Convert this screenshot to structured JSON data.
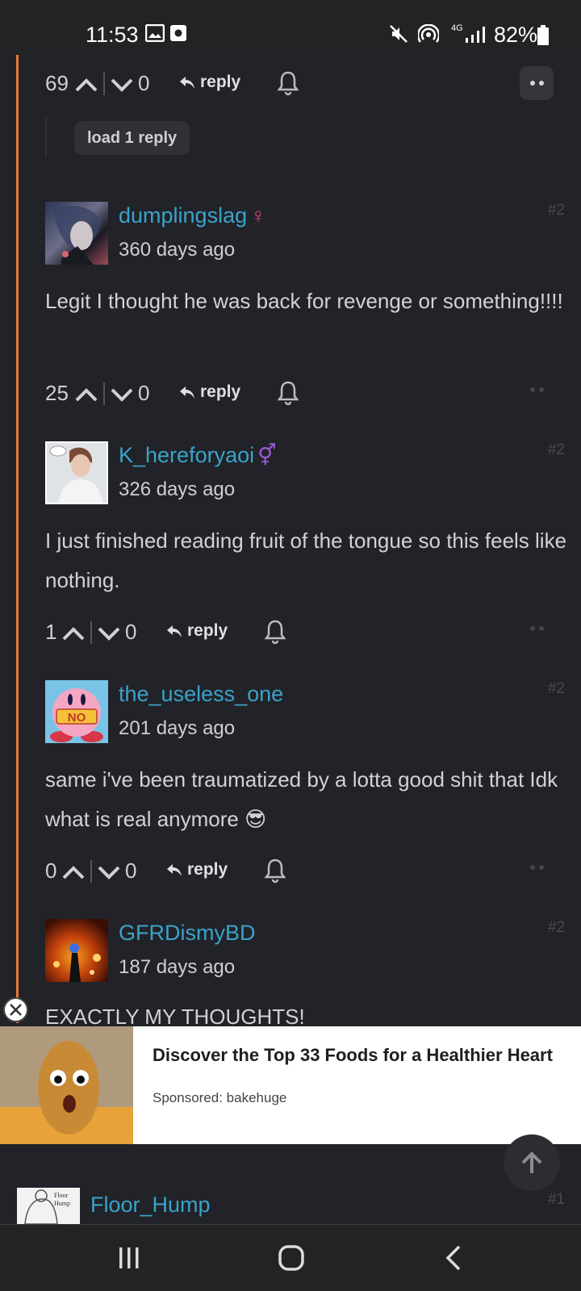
{
  "status_bar": {
    "time": "11:53",
    "network": "4G",
    "battery": "82%",
    "icons": [
      "image-icon",
      "screen-record-icon",
      "mute-icon",
      "hotspot-icon",
      "signal-icon",
      "battery-icon"
    ]
  },
  "top_actions": {
    "upvotes": "69",
    "downvotes": "0",
    "reply_label": "reply"
  },
  "load_reply_label": "load 1 reply",
  "comments": [
    {
      "username": "dumplingslag",
      "gender_symbol": "♀",
      "gender_color": "#e0457b",
      "time_ago": "360 days ago",
      "post_number": "#2",
      "text": "Legit I thought he was back for revenge or something!!!!",
      "upvotes": "25",
      "downvotes": "0",
      "reply_label": "reply"
    },
    {
      "username": "K_hereforyaoi",
      "gender_symbol": "⚥",
      "gender_color": "#9b59d9",
      "time_ago": "326 days ago",
      "post_number": "#2",
      "text": "I just finished reading fruit of the tongue so this feels like nothing.",
      "upvotes": "1",
      "downvotes": "0",
      "reply_label": "reply"
    },
    {
      "username": "the_useless_one",
      "time_ago": "201 days ago",
      "post_number": "#2",
      "text": "same i've been traumatized by a lotta good shit that Idk what is real anymore",
      "emoji": "😎",
      "upvotes": "0",
      "downvotes": "0",
      "reply_label": "reply"
    },
    {
      "username": "GFRDismyBD",
      "time_ago": "187 days ago",
      "post_number": "#2",
      "text": "EXACTLY MY THOUGHTS!"
    },
    {
      "username": "Floor_Hump",
      "post_number": "#1"
    }
  ],
  "ad": {
    "title": "Discover the Top 33 Foods for a Healthier Heart",
    "sponsor": "Sponsored: bakehuge"
  },
  "colors": {
    "accent_orange": "#e8783a",
    "username_blue": "#3aa3c9",
    "background": "#212328"
  }
}
